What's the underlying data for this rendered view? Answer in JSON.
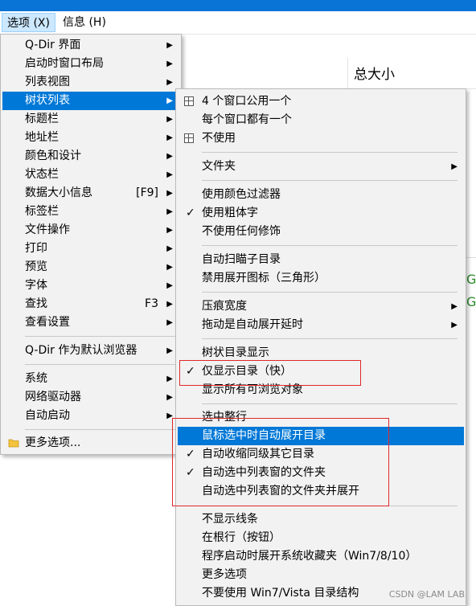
{
  "menubar": {
    "items": [
      {
        "label": "选项 (X)",
        "active": true
      },
      {
        "label": "信息 (H)",
        "active": false
      }
    ]
  },
  "background": {
    "column_header": "总大小",
    "green_glyph": "G"
  },
  "menu1": {
    "items": [
      {
        "label": "Q-Dir 界面",
        "submenu": true
      },
      {
        "label": "启动时窗口布局",
        "submenu": true
      },
      {
        "label": "列表视图",
        "submenu": true
      },
      {
        "label": "树状列表",
        "submenu": true,
        "selected": true
      },
      {
        "label": "标题栏",
        "submenu": true
      },
      {
        "label": "地址栏",
        "submenu": true
      },
      {
        "label": "颜色和设计",
        "submenu": true
      },
      {
        "label": "状态栏",
        "submenu": true
      },
      {
        "label": "数据大小信息",
        "shortcut": "[F9]",
        "submenu": true
      },
      {
        "label": "标签栏",
        "submenu": true
      },
      {
        "label": "文件操作",
        "submenu": true
      },
      {
        "label": "打印",
        "submenu": true
      },
      {
        "label": "预览",
        "submenu": true
      },
      {
        "label": "字体",
        "submenu": true
      },
      {
        "label": "查找",
        "shortcut": "F3",
        "submenu": true
      },
      {
        "label": "查看设置",
        "submenu": true
      },
      {
        "label": "Q-Dir 作为默认浏览器",
        "submenu": true
      },
      {
        "label": "系统",
        "submenu": true
      },
      {
        "label": "网络驱动器",
        "submenu": true
      },
      {
        "label": "自动启动",
        "submenu": true
      },
      {
        "label": "更多选项...",
        "icon": "folder-icon"
      }
    ]
  },
  "menu2": {
    "items": [
      {
        "label": "4 个窗口公用一个",
        "icon": "grid-icon"
      },
      {
        "label": "每个窗口都有一个"
      },
      {
        "label": "不使用",
        "icon": "grid-icon"
      },
      {
        "label": "文件夹",
        "submenu": true
      },
      {
        "label": "使用颜色过滤器"
      },
      {
        "label": "使用粗体字",
        "checked": true
      },
      {
        "label": "不使用任何修饰"
      },
      {
        "label": "自动扫瞄子目录"
      },
      {
        "label": "禁用展开图标（三角形）"
      },
      {
        "label": "压痕宽度",
        "submenu": true
      },
      {
        "label": "拖动是自动展开延时",
        "submenu": true
      },
      {
        "label": "树状目录显示"
      },
      {
        "label": "仅显示目录（快）",
        "checked": true
      },
      {
        "label": "显示所有可浏览对象"
      },
      {
        "label": "选中整行"
      },
      {
        "label": "鼠标选中时自动展开目录",
        "selected": true
      },
      {
        "label": "自动收缩同级其它目录",
        "checked": true
      },
      {
        "label": "自动选中列表窗的文件夹",
        "checked": true
      },
      {
        "label": "自动选中列表窗的文件夹并展开"
      },
      {
        "label": "不显示线条"
      },
      {
        "label": "在根行（按钮）"
      },
      {
        "label": "程序启动时展开系统收藏夹（Win7/8/10）"
      },
      {
        "label": "更多选项"
      },
      {
        "label": "不要使用 Win7/Vista 目录结构"
      }
    ]
  },
  "symbols": {
    "check": "✓",
    "arrow": "▶"
  },
  "watermark": "CSDN @LAM LAB",
  "colors": {
    "selection": "#0078d7",
    "titlebar": "#0a74d6",
    "highlight_box": "#e0272b"
  }
}
